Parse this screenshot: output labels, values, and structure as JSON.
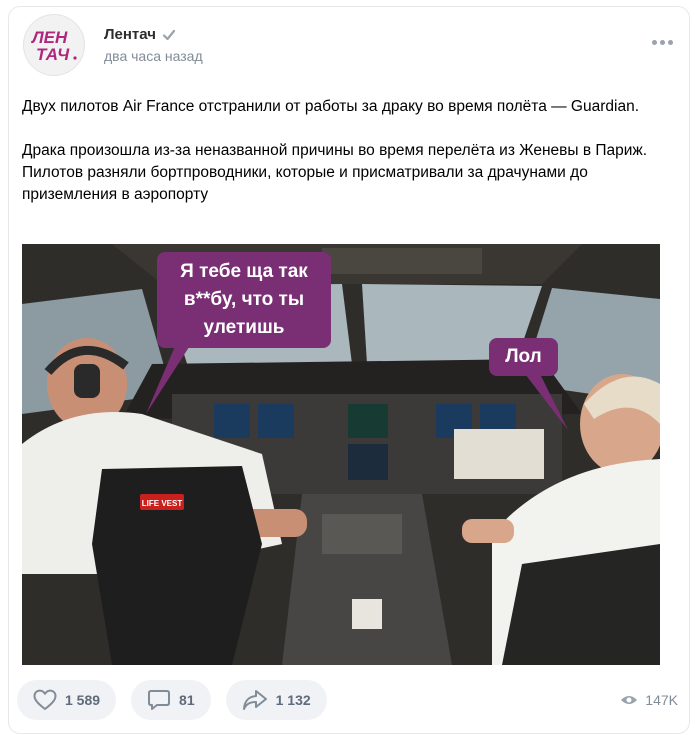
{
  "post": {
    "author": "Лентач",
    "time": "два часа назад",
    "logo_text_top": "ЛЕН",
    "logo_text_bottom": "ТАЧ",
    "paragraph1": "Двух пилотов Air France отстранили от работы за драку во время полёта — Guardian.",
    "paragraph2": "Драка произошла из-за неназванной причины во время перелёта из Женевы в Париж. Пилотов разняли бортпроводники, которые и присматривали за драчунами до приземления в аэропорту"
  },
  "image": {
    "bubble_left": "Я тебе ща так в**бу, что ты улетишь",
    "bubble_right": "Лол",
    "vest_label": "LIFE VEST"
  },
  "footer": {
    "likes": "1 589",
    "comments": "81",
    "shares": "1 132",
    "views": "147K"
  },
  "colors": {
    "brand": "#b0267d",
    "bubble": "#7a2e74",
    "accent": "#99a2ad"
  }
}
